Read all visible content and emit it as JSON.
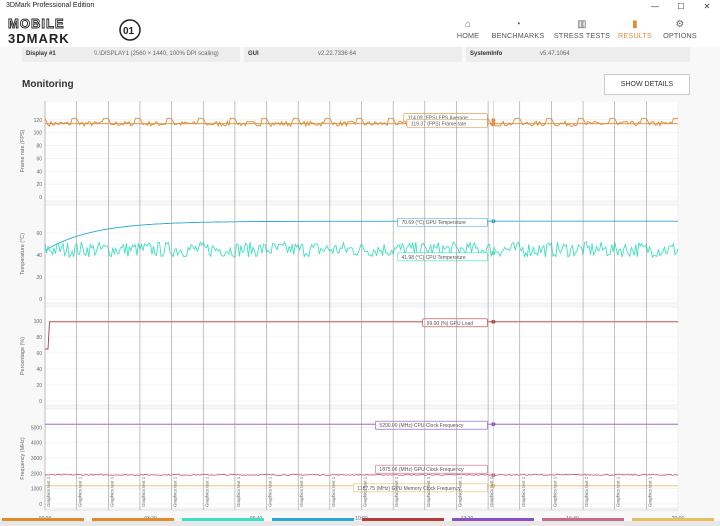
{
  "window": {
    "title": "3DMark Professional Edition",
    "controls": [
      "—",
      "☐",
      "✕"
    ]
  },
  "brand": {
    "logo_top": "MOBILE",
    "logo_bottom": "3DMARK",
    "logo_mark": "01"
  },
  "nav": [
    {
      "label": "HOME",
      "icon": "home-icon",
      "glyph": "⌂",
      "active": false
    },
    {
      "label": "BENCHMARKS",
      "icon": "gauge-icon",
      "glyph": "◔",
      "active": false
    },
    {
      "label": "STRESS TESTS",
      "icon": "bars-icon",
      "glyph": "▥",
      "active": false
    },
    {
      "label": "RESULTS",
      "icon": "results-bars-icon",
      "glyph": "▮",
      "active": true
    },
    {
      "label": "OPTIONS",
      "icon": "gear-icon",
      "glyph": "⚙",
      "active": false
    }
  ],
  "info": {
    "display_label": "Display #1",
    "display_value": "\\\\.\\DISPLAY1 (2560 × 1440, 100% DPI scaling)",
    "gui_label": "GUI",
    "gui_value": "v2.22.7336 64",
    "sysinfo_label": "SystemInfo",
    "sysinfo_value": "v5.47.1064"
  },
  "monitoring": {
    "title": "Monitoring",
    "show_details": "SHOW DETAILS"
  },
  "colors": {
    "accent": "#e28a3a",
    "fps": "#e08a30",
    "gpu_temp": "#29a8d8",
    "cpu_temp": "#3ee0c0",
    "gpu_load": "#b53a3a",
    "cpu_clock": "#8a50c0",
    "gpu_clock": "#c86a8a",
    "gpu_mem_clock": "#e8c060",
    "marker": "#999999"
  },
  "chart_data": {
    "type": "line",
    "x_axis": {
      "ticks": [
        "00:00",
        "03:20",
        "06:40",
        "10:00",
        "13:20",
        "16:40",
        "20:00"
      ],
      "range_s": [
        0,
        1200
      ]
    },
    "marker_label": "Graphics test 1",
    "marker_count": 20,
    "marker_times_s": [
      0,
      60,
      120,
      180,
      240,
      300,
      360,
      420,
      480,
      540,
      600,
      660,
      720,
      780,
      840,
      900,
      960,
      1020,
      1080,
      1140
    ],
    "cursor_time_s": 850,
    "panels": [
      {
        "ylabel": "Frame rate (FPS)",
        "yticks": [
          0,
          20,
          40,
          60,
          80,
          100,
          120
        ],
        "ylim": [
          0,
          140
        ],
        "series": [
          {
            "name": "FPS Average",
            "value": 114.09,
            "unit": "FPS",
            "color_key": "fps",
            "kind": "flat"
          },
          {
            "name": "Frame rate",
            "value": 119.37,
            "unit": "FPS",
            "color_key": "fps",
            "kind": "periodic",
            "base": 114,
            "amp": 12
          }
        ],
        "annotations": [
          {
            "text": "114.09 (FPS) FPS Average"
          },
          {
            "text": "119.37 (FPS) Frame rate"
          }
        ]
      },
      {
        "ylabel": "Temperature (°C)",
        "yticks": [
          0,
          20,
          40,
          60
        ],
        "ylim": [
          0,
          80
        ],
        "series": [
          {
            "name": "GPU Temperature",
            "value": 70.69,
            "unit": "°C",
            "color_key": "gpu_temp",
            "kind": "rise",
            "start": 44,
            "end": 70.7
          },
          {
            "name": "CPU Temperature",
            "value": 41.98,
            "unit": "°C",
            "color_key": "cpu_temp",
            "kind": "noise",
            "base": 45,
            "amp": 7
          }
        ],
        "annotations": [
          {
            "text": "70.69 (°C) GPU Temperature"
          },
          {
            "text": "41.98 (°C) CPU Temperature"
          }
        ]
      },
      {
        "ylabel": "Percentage (%)",
        "yticks": [
          0,
          20,
          40,
          60,
          80,
          100
        ],
        "ylim": [
          0,
          110
        ],
        "series": [
          {
            "name": "GPU Load",
            "value": 99.0,
            "unit": "%",
            "color_key": "gpu_load",
            "kind": "step",
            "start": 65,
            "end": 99
          }
        ],
        "annotations": [
          {
            "text": "99.00 (%) GPU Load"
          }
        ]
      },
      {
        "ylabel": "Frequency (MHz)",
        "yticks": [
          0,
          1000,
          2000,
          3000,
          4000,
          5000
        ],
        "ylim": [
          0,
          5800
        ],
        "series": [
          {
            "name": "CPU Clock Frequency",
            "value": 5200.0,
            "unit": "MHz",
            "color_key": "cpu_clock",
            "kind": "flat"
          },
          {
            "name": "GPU Clock Frequency",
            "value": 1875.06,
            "unit": "MHz",
            "color_key": "gpu_clock",
            "kind": "noise",
            "base": 1900,
            "amp": 40
          },
          {
            "name": "GPU Memory Clock Frequency",
            "value": 1187.75,
            "unit": "MHz",
            "color_key": "gpu_mem_clock",
            "kind": "flat"
          }
        ],
        "annotations": [
          {
            "text": "5200.00 (MHz) CPU Clock Frequency"
          },
          {
            "text": "1875.06 (MHz) GPU Clock Frequency"
          },
          {
            "text": "1187.75 (MHz) GPU Memory Clock Frequency"
          }
        ]
      }
    ]
  },
  "strip_colors": [
    "#e08a30",
    "#e08a30",
    "#3ee0c0",
    "#29a8d8",
    "#b53a3a",
    "#8a50c0",
    "#c86a8a",
    "#e8c060"
  ]
}
